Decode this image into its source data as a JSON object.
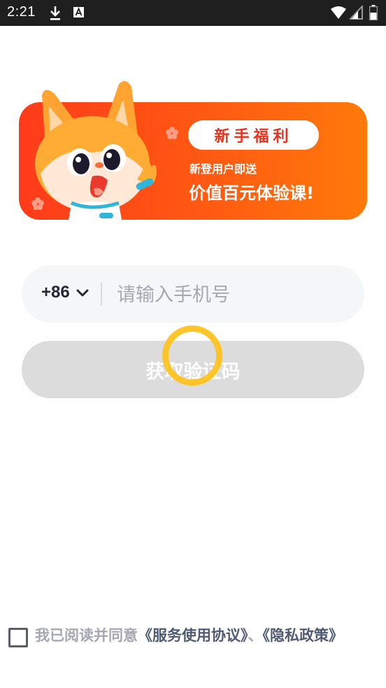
{
  "status_bar": {
    "time": "2:21",
    "icons": [
      "download-icon",
      "a-icon",
      "wifi-icon",
      "signal-icon",
      "battery-icon"
    ]
  },
  "banner": {
    "badge": "新手福利",
    "subtitle": "新登用户即送",
    "headline": "价值百元体验课!",
    "colors": {
      "gradient_start": "#ff3b1a",
      "gradient_end": "#ff7a0a",
      "badge_text": "#e8321e"
    }
  },
  "phone": {
    "country_code": "+86",
    "placeholder": "请输入手机号",
    "value": ""
  },
  "get_code": {
    "label": "获取验证码"
  },
  "agreement": {
    "checked": false,
    "prefix": "我已阅读并同意",
    "service_link": "《服务使用协议》",
    "separator": "、",
    "privacy_link": "《隐私政策》"
  },
  "colors": {
    "accent": "#ff5a12",
    "spinner": "#ffc11a",
    "button_disabled": "#dcdcdc",
    "input_bg": "#f5f6f8"
  }
}
